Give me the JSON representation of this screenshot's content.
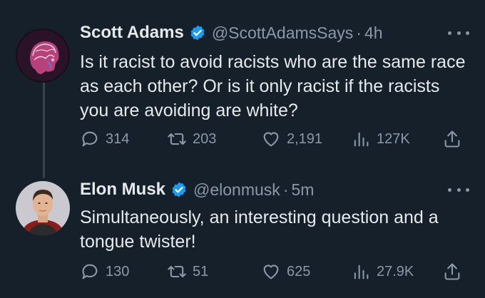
{
  "tweets": [
    {
      "author": "Scott Adams",
      "handle": "@ScottAdamsSays",
      "separator": "·",
      "time": "4h",
      "text": "Is it racist to avoid racists who are the same race as each other? Or is it only racist if the racists you are avoiding are white?",
      "replies": "314",
      "retweets": "203",
      "likes": "2,191",
      "views": "127K"
    },
    {
      "author": "Elon Musk",
      "handle": "@elonmusk",
      "separator": "·",
      "time": "5m",
      "text": "Simultaneously, an interesting question and a tongue twister!",
      "replies": "130",
      "retweets": "51",
      "likes": "625",
      "views": "27.9K"
    }
  ],
  "colors": {
    "background": "#15202b",
    "text": "#e7e9ea",
    "muted": "#8b98a5",
    "verified": "#1d9bf0",
    "thread_line": "#38444d"
  },
  "icons": [
    "verified-badge-icon",
    "more-icon",
    "reply-icon",
    "retweet-icon",
    "like-icon",
    "views-icon",
    "share-icon"
  ]
}
